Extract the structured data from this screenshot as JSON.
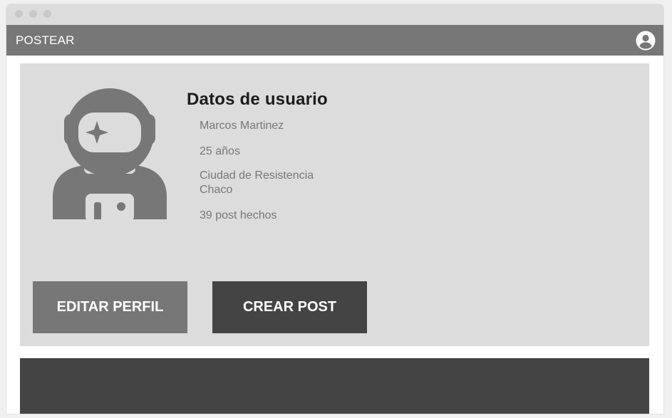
{
  "header": {
    "brand": "POSTEAR",
    "account_icon": "account-circle-icon"
  },
  "profile": {
    "avatar_icon": "astronaut-icon",
    "section_title": "Datos de usuario",
    "name": "Marcos Martinez",
    "age": "25 años",
    "city": "Ciudad de Resistencia",
    "province": "Chaco",
    "posts": "39 post hechos"
  },
  "actions": {
    "edit_label": "EDITAR PERFIL",
    "create_label": "CREAR POST"
  },
  "colors": {
    "navbar": "#777777",
    "card": "#dcdcdc",
    "dark": "#444444"
  }
}
